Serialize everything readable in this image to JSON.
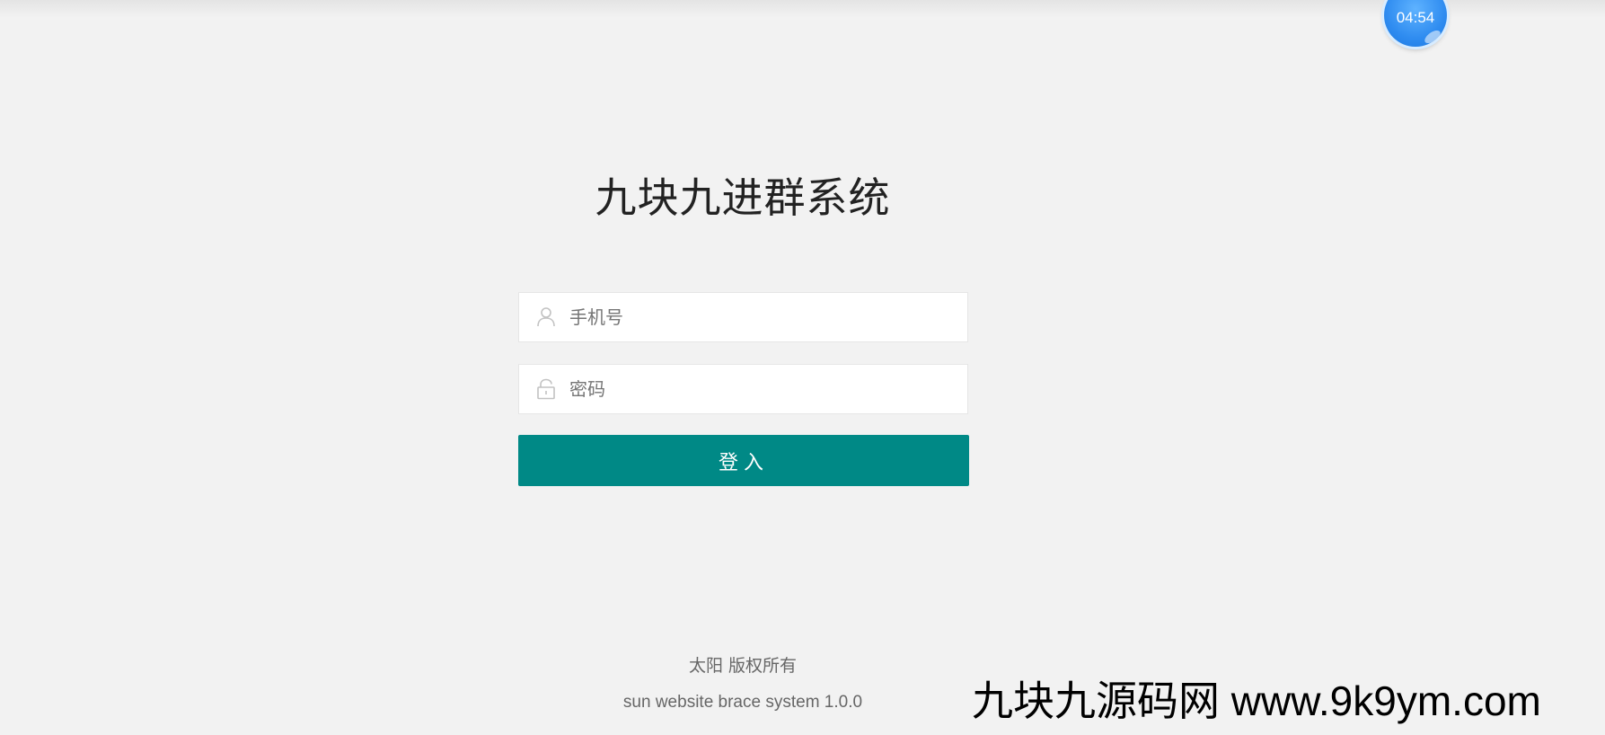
{
  "timer": {
    "text": "04:54",
    "color": "#2f8cf0"
  },
  "login": {
    "title": "九块九进群系统",
    "phone_placeholder": "手机号",
    "password_placeholder": "密码",
    "submit_label": "登入",
    "icons": {
      "phone": "user-icon",
      "password": "lock-icon"
    },
    "button_color": "#008986"
  },
  "footer": {
    "copyright": "太阳 版权所有",
    "version": "sun website brace system 1.0.0"
  },
  "watermark": {
    "text": "九块九源码网 www.9k9ym.com"
  }
}
